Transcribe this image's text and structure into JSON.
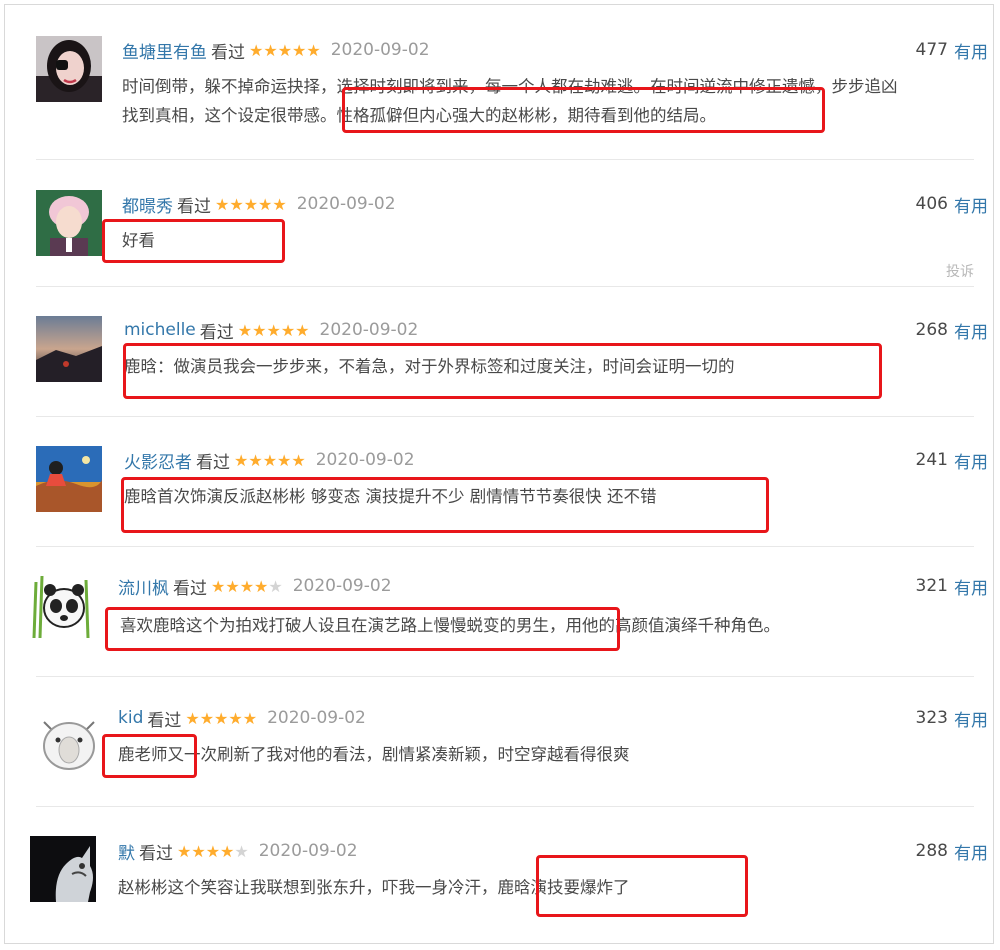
{
  "comments": [
    {
      "user": "鱼塘里有鱼",
      "status": "看过",
      "rating": 5,
      "date": "2020-09-02",
      "votes": "477",
      "vote_label": "有用",
      "line1": "时间倒带，躲不掉命运抉择，选择时刻即将到来，每一个人都在劫难逃。在时间逆流中修正遗憾，步步追凶",
      "line2": "找到真相，这个设定很带感。性格孤僻但内心强大的赵彬彬，期待看到他的结局。"
    },
    {
      "user": "都暻秀",
      "status": "看过",
      "rating": 5,
      "date": "2020-09-02",
      "votes": "406",
      "vote_label": "有用",
      "line1": "好看",
      "report": "投诉"
    },
    {
      "user": "michelle",
      "status": "看过",
      "rating": 5,
      "date": "2020-09-02",
      "votes": "268",
      "vote_label": "有用",
      "line1": "鹿晗：做演员我会一步步来，不着急，对于外界标签和过度关注，时间会证明一切的"
    },
    {
      "user": "火影忍者",
      "status": "看过",
      "rating": 5,
      "date": "2020-09-02",
      "votes": "241",
      "vote_label": "有用",
      "line1": "鹿晗首次饰演反派赵彬彬 够变态 演技提升不少 剧情情节节奏很快 还不错"
    },
    {
      "user": "流川枫",
      "status": "看过",
      "rating": 4,
      "date": "2020-09-02",
      "votes": "321",
      "vote_label": "有用",
      "line1": "喜欢鹿晗这个为拍戏打破人设且在演艺路上慢慢蜕变的男生，用他的高颜值演绎千种角色。"
    },
    {
      "user": "kid",
      "status": "看过",
      "rating": 5,
      "date": "2020-09-02",
      "votes": "323",
      "vote_label": "有用",
      "line1": "鹿老师又一次刷新了我对他的看法，剧情紧凑新颖，时空穿越看得很爽"
    },
    {
      "user": "默",
      "status": "看过",
      "rating": 4,
      "date": "2020-09-02",
      "votes": "288",
      "vote_label": "有用",
      "line1": "赵彬彬这个笑容让我联想到张东升，吓我一身冷汗，鹿晗演技要爆炸了"
    }
  ],
  "colors": {
    "username": "#3377aa",
    "star": "#ffac2d",
    "highlight": "#e8161a",
    "text": "#494949"
  }
}
